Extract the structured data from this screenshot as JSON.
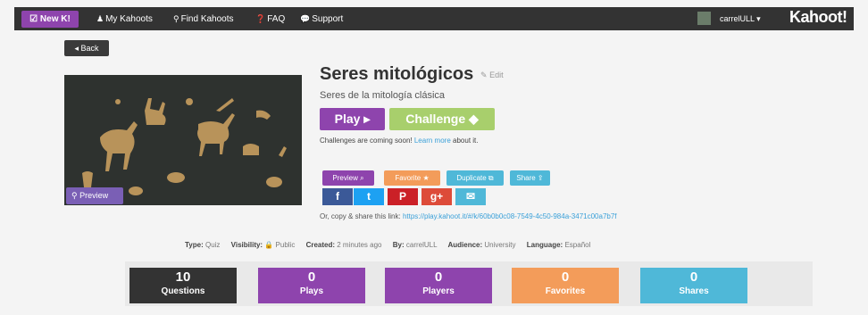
{
  "nav": {
    "new_k": "☑ New K!",
    "my_kahoots": "My Kahoots",
    "find_kahoots": "Find Kahoots",
    "faq": "FAQ",
    "support": "Support",
    "user": "carrelULL ▾",
    "brand": "Kahoot!"
  },
  "back_label": "Back",
  "kahoot": {
    "title": "Seres mitológicos",
    "edit_label": "Edit",
    "description": "Seres de la mitología clásica",
    "cover_preview_label": "Preview"
  },
  "actions": {
    "play": "Play ▸",
    "challenge": "Challenge ◆",
    "challenge_note": "Challenges are coming soon!",
    "learn_more": "Learn more",
    "about_it": "about it.",
    "preview": "Preview ⌕",
    "favorite": "Favorite ★",
    "duplicate": "Duplicate ⧉",
    "share": "Share ⇪"
  },
  "share": {
    "facebook": "f",
    "twitter": "t",
    "pinterest": "P",
    "googleplus": "g+",
    "email": "✉",
    "link_prefix": "Or, copy & share this link:",
    "link_url": "https://play.kahoot.it/#/k/60b0b0c08-7549-4c50-984a-3471c00a7b7f"
  },
  "meta": {
    "type_label": "Type:",
    "type_value": "Quiz",
    "visibility_label": "Visibility:",
    "visibility_value": "Public",
    "created_label": "Created:",
    "created_value": "2 minutes ago",
    "by_label": "By:",
    "by_value": "carrelULL",
    "audience_label": "Audience:",
    "audience_value": "University",
    "language_label": "Language:",
    "language_value": "Español"
  },
  "stats": [
    {
      "value": "10",
      "label": "Questions",
      "color": "#333333"
    },
    {
      "value": "0",
      "label": "Plays",
      "color": "#8e44ad"
    },
    {
      "value": "0",
      "label": "Players",
      "color": "#8e44ad"
    },
    {
      "value": "0",
      "label": "Favorites",
      "color": "#f39c5a"
    },
    {
      "value": "0",
      "label": "Shares",
      "color": "#4fb8d8"
    }
  ],
  "colors": {
    "nav_bg": "#333333",
    "purple": "#8e44ad",
    "green": "#a8cf6c",
    "orange": "#f39c5a",
    "cyan": "#4fb8d8",
    "link": "#3aa0d8"
  }
}
